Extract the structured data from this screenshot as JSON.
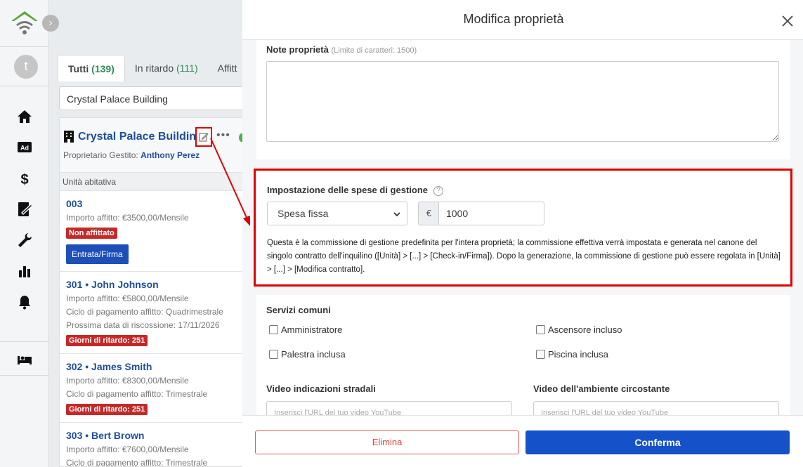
{
  "sidebar": {
    "avatar_letter": "t",
    "expand_glyph": "›",
    "nav": [
      "home-icon",
      "ad-icon",
      "dollar-icon",
      "contract-icon",
      "wrench-icon",
      "chart-icon",
      "bell-icon",
      "bed-icon"
    ],
    "ad_label": "Ad"
  },
  "tabs": [
    {
      "label": "Tutti",
      "count": "(139)"
    },
    {
      "label": "In ritardo",
      "count": "(111)"
    },
    {
      "label": "Affitt",
      "count": ""
    }
  ],
  "building_filter": "Crystal Palace Building",
  "building": {
    "name": "Crystal Palace Building",
    "owner_label": "Proprietario Gestito:",
    "owner_name": "Anthony Perez",
    "more": "•••"
  },
  "units_header": "Unità abitativa",
  "units": [
    {
      "title": "003",
      "rent": "Importo affitto: €3500,00/Mensile",
      "badge": "Non affittato",
      "action": "Entrata/Firma"
    },
    {
      "title": "301 • John Johnson",
      "rent": "Importo affitto: €5800,00/Mensile",
      "cycle": "Ciclo di pagamento affitto: Quadrimestrale",
      "next": "Prossima data di riscossione:  17/11/2026",
      "badge": "Giorni di ritardo: 251"
    },
    {
      "title": "302 • James Smith",
      "rent": "Importo affitto: €8300,00/Mensile",
      "cycle": "Ciclo di pagamento affitto: Trimestrale",
      "badge": "Giorni di ritardo: 251"
    },
    {
      "title": "303 • Bert Brown",
      "rent": "Importo affitto: €7600,00/Mensile",
      "cycle": "Ciclo di pagamento affitto: Trimestrale"
    }
  ],
  "modal": {
    "title": "Modifica proprietà",
    "close_glyph": "✕",
    "notes_label": "Note proprietà",
    "notes_hint": "(Limite di caratteri: 1500)",
    "notes_value": "",
    "fee_label": "Impostazione delle spese di gestione",
    "help_glyph": "?",
    "fee_type": "Spesa fissa",
    "currency": "€",
    "fee_amount": "1000",
    "fee_desc": "Questa è la commissione di gestione predefinita per l'intera proprietà; la commissione effettiva verrà impostata e generata nel canone del singolo contratto dell'inquilino ([Unità] > [...] > [Check-in/Firma]). Dopo la generazione, la commissione di gestione può essere regolata in [Unità] > [...] > [Modifica contratto].",
    "amenities_label": "Servizi comuni",
    "amenities": [
      "Amministratore",
      "Ascensore incluso",
      "Palestra inclusa",
      "Piscina inclusa"
    ],
    "video_directions_label": "Video indicazioni stradali",
    "video_area_label": "Video dell'ambiente circostante",
    "video_placeholder": "Inserisci l'URL del tuo video YouTube",
    "delete_label": "Elimina",
    "confirm_label": "Conferma"
  }
}
